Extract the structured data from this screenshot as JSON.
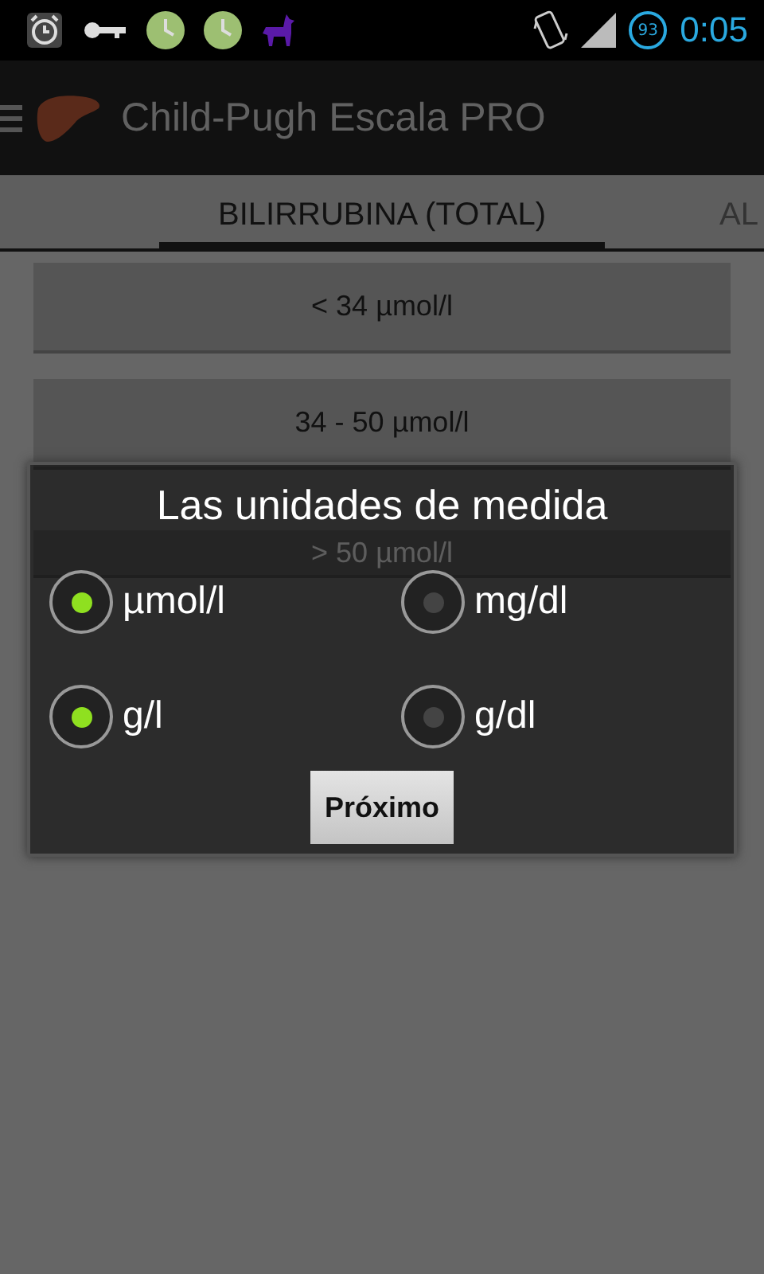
{
  "status_bar": {
    "battery": "93",
    "time": "0:05"
  },
  "app_bar": {
    "title": "Child-Pugh Escala PRO"
  },
  "tabs": [
    {
      "label": "BILIRRUBINA (TOTAL)",
      "selected": true
    },
    {
      "label": "AL",
      "selected": false
    }
  ],
  "options": [
    "< 34 µmol/l",
    "34 - 50 µmol/l",
    "> 50 µmol/l"
  ],
  "dialog": {
    "title": "Las unidades de medida",
    "rows": [
      {
        "choices": [
          {
            "label": "µmol/l",
            "selected": true
          },
          {
            "label": "mg/dl",
            "selected": false
          }
        ]
      },
      {
        "choices": [
          {
            "label": "g/l",
            "selected": true
          },
          {
            "label": "g/dl",
            "selected": false
          }
        ]
      }
    ],
    "button": "Próximo"
  }
}
